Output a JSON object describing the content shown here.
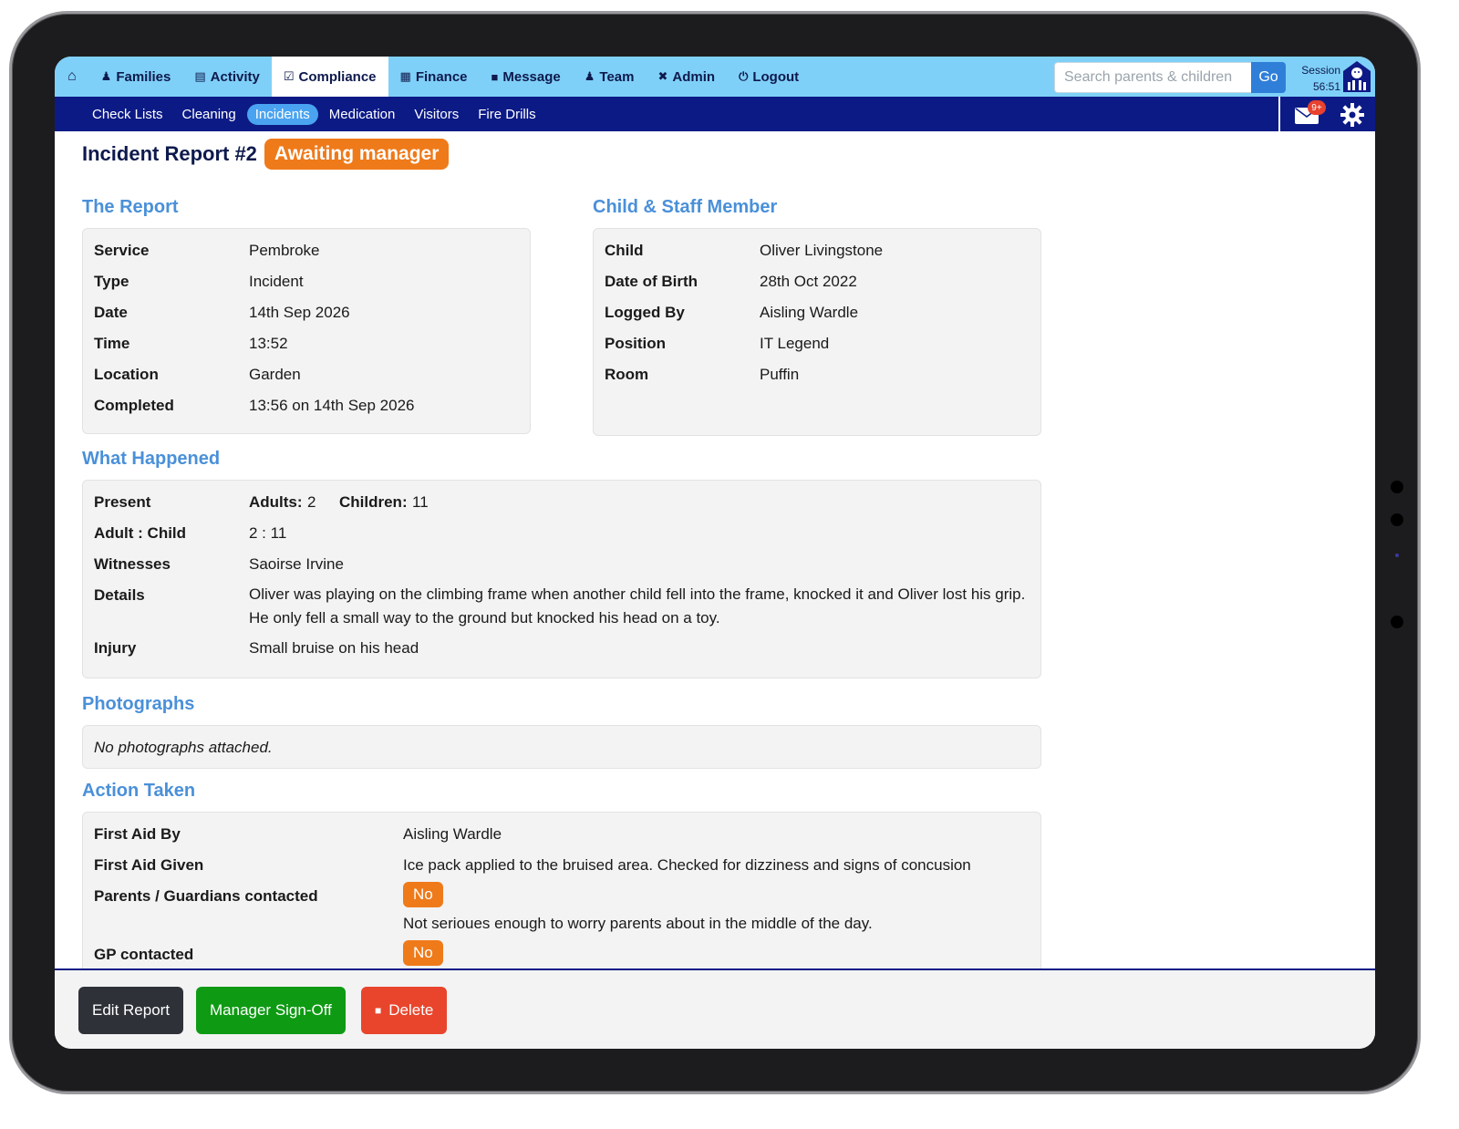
{
  "nav": {
    "home_icon": "home-icon",
    "items": [
      {
        "label": "Families",
        "icon": "family-icon"
      },
      {
        "label": "Activity",
        "icon": "clipboard-icon"
      },
      {
        "label": "Compliance",
        "icon": "checklist-icon"
      },
      {
        "label": "Finance",
        "icon": "bank-icon"
      },
      {
        "label": "Message",
        "icon": "chat-icon"
      },
      {
        "label": "Team",
        "icon": "person-icon"
      },
      {
        "label": "Admin",
        "icon": "tools-icon"
      },
      {
        "label": "Logout",
        "icon": "power-icon"
      }
    ],
    "active": "Compliance",
    "search_placeholder": "Search parents & children",
    "go_label": "Go",
    "session_label": "Session",
    "session_time": "56:51"
  },
  "subnav": {
    "items": [
      "Check Lists",
      "Cleaning",
      "Incidents",
      "Medication",
      "Visitors",
      "Fire Drills"
    ],
    "active": "Incidents",
    "mail_badge": "9+"
  },
  "report": {
    "title": "Incident Report #2",
    "status": "Awaiting manager",
    "sections": {
      "report": "The Report",
      "child_staff": "Child & Staff Member",
      "what_happened": "What Happened",
      "photographs": "Photographs",
      "action": "Action Taken"
    },
    "the_report": [
      {
        "label": "Service",
        "value": "Pembroke"
      },
      {
        "label": "Type",
        "value": "Incident"
      },
      {
        "label": "Date",
        "value": "14th Sep 2026"
      },
      {
        "label": "Time",
        "value": "13:52"
      },
      {
        "label": "Location",
        "value": "Garden"
      },
      {
        "label": "Completed",
        "value": "13:56 on 14th Sep 2026"
      }
    ],
    "child_staff": [
      {
        "label": "Child",
        "value": "Oliver Livingstone"
      },
      {
        "label": "Date of Birth",
        "value": "28th Oct 2022"
      },
      {
        "label": "Logged By",
        "value": "Aisling Wardle"
      },
      {
        "label": "Position",
        "value": "IT Legend"
      },
      {
        "label": "Room",
        "value": "Puffin"
      }
    ],
    "what_happened": {
      "present_label": "Present",
      "adults_label": "Adults:",
      "adults_value": "2",
      "children_label": "Children:",
      "children_value": "11",
      "ratio_label": "Adult : Child",
      "ratio_value": "2 : 11",
      "witnesses_label": "Witnesses",
      "witnesses_value": "Saoirse Irvine",
      "details_label": "Details",
      "details_value": "Oliver was playing on the climbing frame when another child fell into the frame, knocked it and Oliver lost his grip. He only fell a small way to the ground but knocked his head on a toy.",
      "injury_label": "Injury",
      "injury_value": "Small bruise on his head"
    },
    "photographs": "No photographs attached.",
    "action": {
      "first_aid_by_label": "First Aid By",
      "first_aid_by_value": "Aisling Wardle",
      "first_aid_given_label": "First Aid Given",
      "first_aid_given_value": "Ice pack applied to the bruised area. Checked for dizziness and signs of concusion",
      "parents_label": "Parents / Guardians contacted",
      "parents_value": "No",
      "parents_note": "Not serioues enough to worry parents about in the middle of the day.",
      "gp_label": "GP contacted",
      "gp_value": "No"
    }
  },
  "footer": {
    "edit_label": "Edit Report",
    "signoff_label": "Manager Sign-Off",
    "delete_label": "Delete"
  },
  "colors": {
    "topnav_bg": "#7fd0f8",
    "subnav_bg": "#0c1a86",
    "section_heading": "#4a90d9",
    "status_orange": "#ef7a1a",
    "signoff_green": "#0f9a14",
    "delete_red": "#e8452c"
  }
}
